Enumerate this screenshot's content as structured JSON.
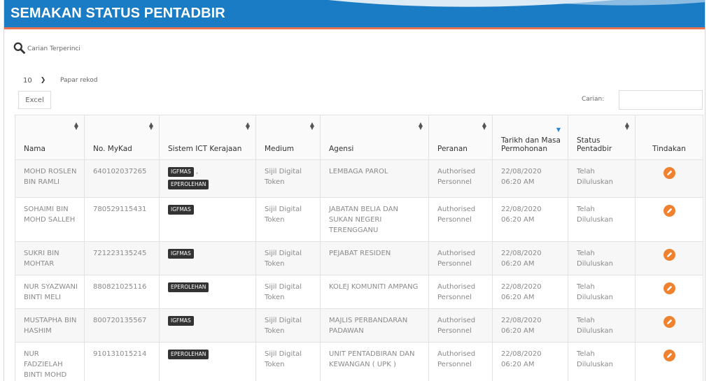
{
  "header": {
    "title": "SEMAKAN STATUS PENTADBIR",
    "colors": {
      "bar": "#1a7cc4",
      "accent": "#e8734e"
    }
  },
  "advanced_search": {
    "icon": "search-icon",
    "label": "Carian Terperinci"
  },
  "page_length": {
    "selected": "10",
    "label": "Papar rekod"
  },
  "toolbar": {
    "excel_label": "Excel"
  },
  "search": {
    "label": "Carian:",
    "value": ""
  },
  "table": {
    "columns": [
      {
        "label": "Nama",
        "sortable": true
      },
      {
        "label": "No. MyKad",
        "sortable": true
      },
      {
        "label": "Sistem ICT Kerajaan",
        "sortable": true
      },
      {
        "label": "Medium",
        "sortable": true
      },
      {
        "label": "Agensi",
        "sortable": true
      },
      {
        "label": "Peranan",
        "sortable": true
      },
      {
        "label": "Tarikh dan Masa Permohonan",
        "sortable": true,
        "sorted": "desc"
      },
      {
        "label": "Status Pentadbir",
        "sortable": true
      },
      {
        "label": "Tindakan",
        "sortable": false
      }
    ],
    "rows": [
      {
        "nama": "MOHD ROSLEN BIN RAMLI",
        "mykad": "640102037265",
        "sistem": [
          "IGFMAS",
          "EPEROLEHAN"
        ],
        "medium": "Sijil Digital Token",
        "agensi": "LEMBAGA PAROL",
        "peranan": "Authorised Personnel",
        "tarikh": "22/08/2020 06:20 AM",
        "status": "Telah Diluluskan",
        "action_icon": "edit-icon"
      },
      {
        "nama": "SOHAIMI BIN MOHD SALLEH",
        "mykad": "780529115431",
        "sistem": [
          "IGFMAS"
        ],
        "medium": "Sijil Digital Token",
        "agensi": "JABATAN BELIA DAN SUKAN NEGERI TERENGGANU",
        "peranan": "Authorised Personnel",
        "tarikh": "22/08/2020 06:20 AM",
        "status": "Telah Diluluskan",
        "action_icon": "edit-icon"
      },
      {
        "nama": "SUKRI BIN MOHTAR",
        "mykad": "721223135245",
        "sistem": [
          "IGFMAS"
        ],
        "medium": "Sijil Digital Token",
        "agensi": "PEJABAT RESIDEN",
        "peranan": "Authorised Personnel",
        "tarikh": "22/08/2020 06:20 AM",
        "status": "Telah Diluluskan",
        "action_icon": "edit-icon"
      },
      {
        "nama": "NUR SYAZWANI BINTI MELI",
        "mykad": "880821025116",
        "sistem": [
          "EPEROLEHAN"
        ],
        "medium": "Sijil Digital Token",
        "agensi": "KOLEJ KOMUNITI AMPANG",
        "peranan": "Authorised Personnel",
        "tarikh": "22/08/2020 06:20 AM",
        "status": "Telah Diluluskan",
        "action_icon": "edit-icon"
      },
      {
        "nama": "MUSTAPHA BIN HASHIM",
        "mykad": "800720135567",
        "sistem": [
          "IGFMAS"
        ],
        "medium": "Sijil Digital Token",
        "agensi": "MAJLIS PERBANDARAN PADAWAN",
        "peranan": "Authorised Personnel",
        "tarikh": "22/08/2020 06:20 AM",
        "status": "Telah Diluluskan",
        "action_icon": "edit-icon"
      },
      {
        "nama": "NUR FADZIELAH BINTI MOHD FADZIL",
        "mykad": "910131015214",
        "sistem": [
          "EPEROLEHAN"
        ],
        "medium": "Sijil Digital Token",
        "agensi": "UNIT PENTADBIRAN DAN KEWANGAN ( UPK )",
        "peranan": "Authorised Personnel",
        "tarikh": "22/08/2020 06:20 AM",
        "status": "Telah Diluluskan",
        "action_icon": "edit-icon"
      }
    ]
  }
}
